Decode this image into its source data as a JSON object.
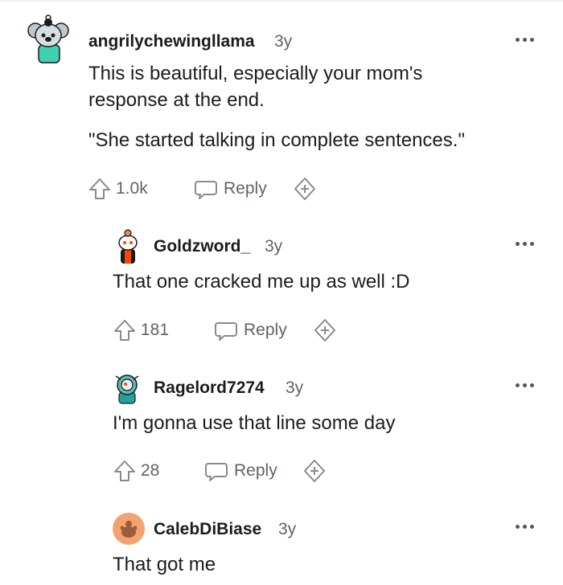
{
  "comments": [
    {
      "username": "angrilychewingllama",
      "age": "3y",
      "paragraphs": [
        "This is beautiful, especially your mom's response at the end.",
        "\"She started talking in complete sentences.\""
      ],
      "votes": "1.0k",
      "reply_label": "Reply",
      "avatar": "snoo-avatar-koala-green",
      "more_icon": "more-options-icon"
    },
    {
      "username": "Goldzword_",
      "age": "3y",
      "paragraphs": [
        "That one cracked me up as well :D"
      ],
      "votes": "181",
      "reply_label": "Reply",
      "avatar": "snoo-avatar-orange-red",
      "more_icon": "more-options-icon"
    },
    {
      "username": "Ragelord7274",
      "age": "3y",
      "paragraphs": [
        "I'm gonna use that line some day"
      ],
      "votes": "28",
      "reply_label": "Reply",
      "avatar": "snoo-avatar-teal-helmet",
      "more_icon": "more-options-icon"
    },
    {
      "username": "CalebDiBiase",
      "age": "3y",
      "paragraphs": [
        "That got me"
      ],
      "avatar": "default-avatar-orange",
      "more_icon": "more-options-icon"
    }
  ],
  "colors": {
    "text": "#1c1c1c",
    "meta": "#5f6368",
    "icon": "#878a8c",
    "default_avatar": "#f4a370"
  }
}
